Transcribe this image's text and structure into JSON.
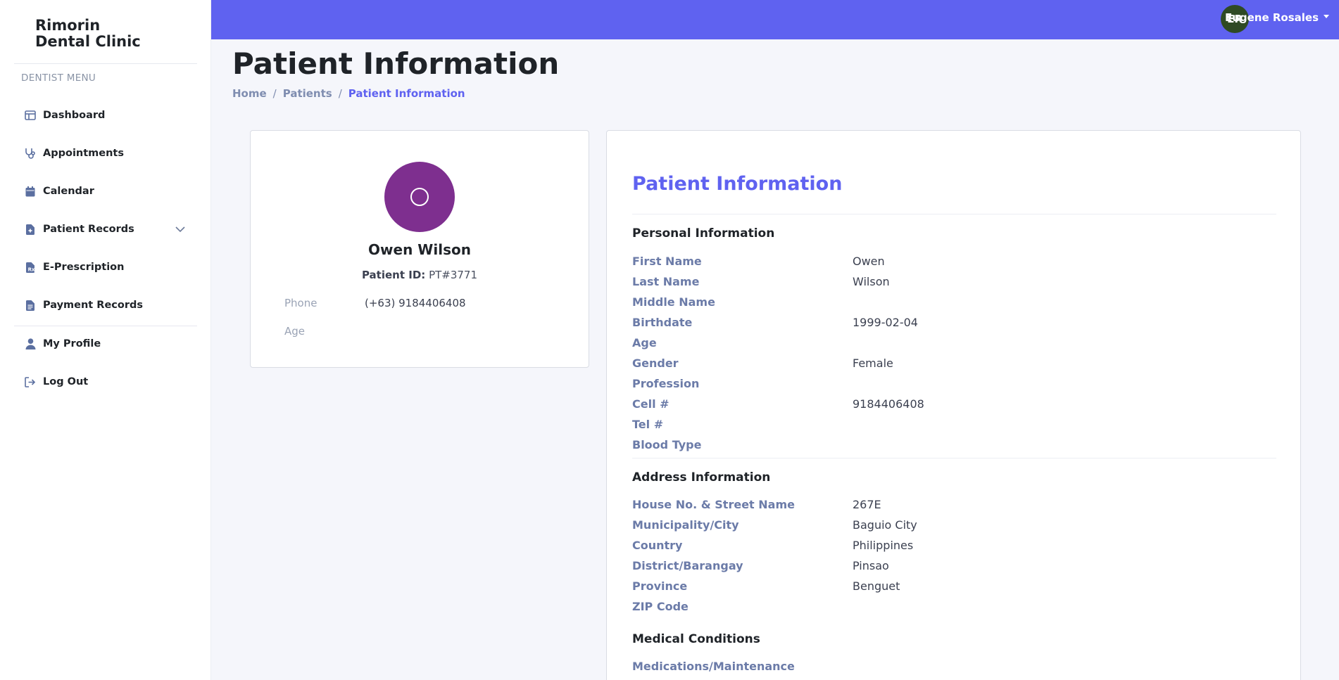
{
  "brand": {
    "line1": "Rimorin",
    "line2": "Dental Clinic"
  },
  "sidebar": {
    "heading": "DENTIST MENU",
    "items": [
      {
        "label": "Dashboard",
        "icon": "dashboard-icon"
      },
      {
        "label": "Appointments",
        "icon": "stethoscope-icon"
      },
      {
        "label": "Calendar",
        "icon": "calendar-icon"
      },
      {
        "label": "Patient Records",
        "icon": "medical-file-icon"
      },
      {
        "label": "E-Prescription",
        "icon": "prescription-icon"
      },
      {
        "label": "Payment Records",
        "icon": "receipt-icon"
      },
      {
        "label": "My Profile",
        "icon": "user-icon"
      },
      {
        "label": "Log Out",
        "icon": "logout-icon"
      }
    ]
  },
  "topbar": {
    "user_initials": "ER",
    "user_name": "Eugene Rosales",
    "color": "#5f62f0"
  },
  "page": {
    "title": "Patient Information",
    "breadcrumb": {
      "home": "Home",
      "patients": "Patients",
      "current": "Patient Information"
    }
  },
  "profile": {
    "avatar_color": "#7e2f8f",
    "name": "Owen Wilson",
    "patient_id_label": "Patient ID:",
    "patient_id": "PT#3771",
    "phone_label": "Phone",
    "phone": "(+63) 9184406408",
    "age_label": "Age",
    "age": ""
  },
  "info": {
    "title": "Patient Information",
    "personal": {
      "title": "Personal Information",
      "rows": [
        {
          "label": "First Name",
          "value": "Owen"
        },
        {
          "label": "Last Name",
          "value": "Wilson"
        },
        {
          "label": "Middle Name",
          "value": ""
        },
        {
          "label": "Birthdate",
          "value": "1999-02-04"
        },
        {
          "label": "Age",
          "value": ""
        },
        {
          "label": "Gender",
          "value": "Female"
        },
        {
          "label": "Profession",
          "value": ""
        },
        {
          "label": "Cell #",
          "value": "9184406408"
        },
        {
          "label": "Tel #",
          "value": ""
        },
        {
          "label": "Blood Type",
          "value": ""
        }
      ]
    },
    "address": {
      "title": "Address Information",
      "rows": [
        {
          "label": "House No. & Street Name",
          "value": "267E"
        },
        {
          "label": "Municipality/City",
          "value": "Baguio City"
        },
        {
          "label": "Country",
          "value": "Philippines"
        },
        {
          "label": "District/Barangay",
          "value": "Pinsao"
        },
        {
          "label": "Province",
          "value": "Benguet"
        },
        {
          "label": "ZIP Code",
          "value": ""
        }
      ]
    },
    "medical": {
      "title": "Medical Conditions",
      "rows": [
        {
          "label": "Medications/Maintenance",
          "value": ""
        }
      ]
    }
  }
}
